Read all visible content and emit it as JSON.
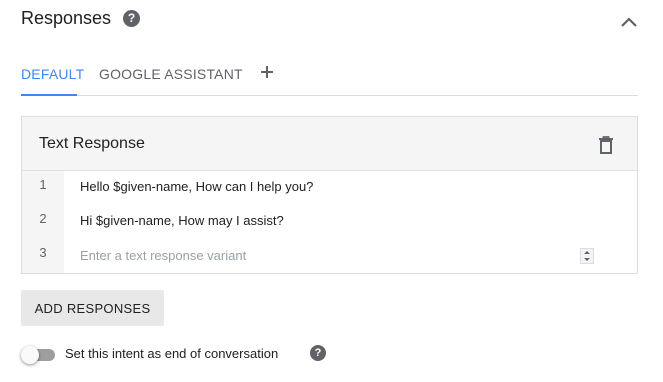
{
  "header": {
    "title": "Responses",
    "help_glyph": "?",
    "collapse_icon": "chevron-up-icon"
  },
  "tabs": [
    {
      "label": "DEFAULT",
      "active": true
    },
    {
      "label": "GOOGLE ASSISTANT",
      "active": false
    }
  ],
  "add_tab_icon": "plus-icon",
  "card": {
    "title": "Text Response",
    "delete_icon": "trash-icon",
    "rows": [
      {
        "num": "1",
        "text": "Hello $given-name, How can I help you?"
      },
      {
        "num": "2",
        "text": "Hi $given-name, How may I assist?"
      },
      {
        "num": "3",
        "value": "",
        "placeholder": "Enter a text response variant"
      }
    ]
  },
  "add_responses_label": "ADD RESPONSES",
  "end_conversation": {
    "label": "Set this intent as end of conversation",
    "enabled": false,
    "help_glyph": "?"
  },
  "colors": {
    "accent": "#4285f4",
    "icon": "#5f6368",
    "card_header_bg": "#f5f5f5",
    "button_bg": "#e8e8e8"
  }
}
